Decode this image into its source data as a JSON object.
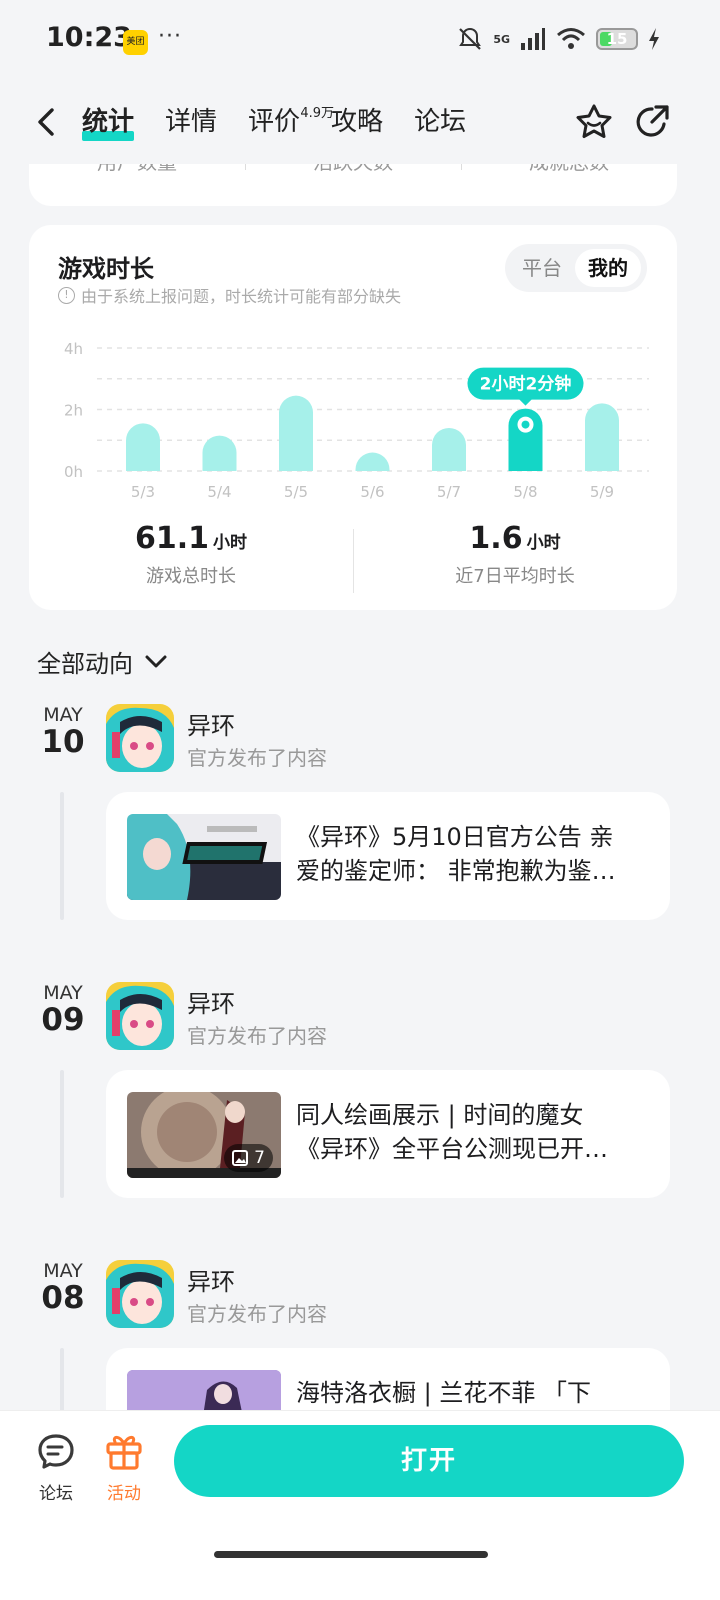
{
  "status": {
    "time": "10:23",
    "app_badge": "美团",
    "more": "···",
    "network": "5G",
    "battery": "15"
  },
  "header": {
    "tabs": [
      {
        "label": "统计",
        "active": true
      },
      {
        "label": "详情"
      },
      {
        "label": "评价",
        "badge": "4.9万"
      },
      {
        "label": "攻略"
      },
      {
        "label": "论坛"
      }
    ]
  },
  "top_card": {
    "labels": [
      "用户数量",
      "活跃天数",
      "成就总数"
    ]
  },
  "playtime": {
    "title": "游戏时长",
    "note": "由于系统上报问题，时长统计可能有部分缺失",
    "segments": [
      "平台",
      "我的"
    ],
    "selected_segment": "我的",
    "total_value": "61.1",
    "total_unit": "小时",
    "total_caption": "游戏总时长",
    "avg_value": "1.6",
    "avg_unit": "小时",
    "avg_caption": "近7日平均时长"
  },
  "chart_data": {
    "type": "bar",
    "categories": [
      "5/3",
      "5/4",
      "5/5",
      "5/6",
      "5/7",
      "5/8",
      "5/9"
    ],
    "values": [
      1.55,
      1.15,
      2.45,
      0.6,
      1.4,
      2.03,
      2.2
    ],
    "y_ticks": [
      "0h",
      "2h",
      "4h"
    ],
    "ylim": [
      0,
      4
    ],
    "grid": true,
    "highlight_index": 5,
    "highlight_label": "2小时2分钟",
    "color": "#a6f0ea",
    "highlight_color": "#14d6c6"
  },
  "feed": {
    "filter": "全部动向",
    "entries": [
      {
        "month": "MAY",
        "day": "10",
        "author": "异环",
        "action": "官方发布了内容",
        "line1": "《异环》5月10日官方公告 亲",
        "line2": "爱的鉴定师： 非常抱歉为鉴…",
        "image_count": ""
      },
      {
        "month": "MAY",
        "day": "09",
        "author": "异环",
        "action": "官方发布了内容",
        "line1": "同人绘画展示 | 时间的魔女",
        "line2": "《异环》全平台公测现已开…",
        "image_count": "7"
      },
      {
        "month": "MAY",
        "day": "08",
        "author": "异环",
        "action": "官方发布了内容",
        "line1": "海特洛衣橱 | 兰花不菲 「下",
        "line2": "",
        "image_count": ""
      }
    ]
  },
  "bottom": {
    "forum": "论坛",
    "activity": "活动",
    "open": "打开"
  }
}
